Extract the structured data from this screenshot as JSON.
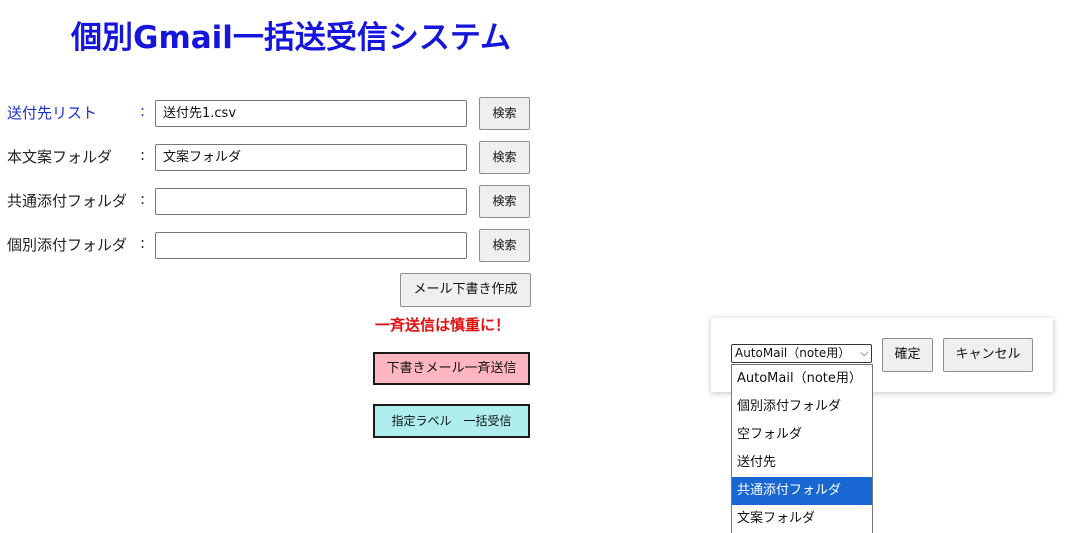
{
  "title": "個別Gmail一括送受信システム",
  "form": {
    "rows": [
      {
        "label": "送付先リスト",
        "colon": ":",
        "value": "送付先1.csv",
        "button": "検索"
      },
      {
        "label": "本文案フォルダ",
        "colon": ":",
        "value": "文案フォルダ",
        "button": "検索"
      },
      {
        "label": "共通添付フォルダ",
        "colon": ":",
        "value": "",
        "button": "検索"
      },
      {
        "label": "個別添付フォルダ",
        "colon": ":",
        "value": "",
        "button": "検索"
      }
    ],
    "draft_button": "メール下書き作成",
    "warning": "一斉送信は慎重に！",
    "send_button": "下書きメール一斉送信",
    "receive_button": "指定ラベル　一括受信"
  },
  "dialog": {
    "select_value": "AutoMail（note用）",
    "confirm_button": "確定",
    "cancel_button": "キャンセル",
    "options": [
      "AutoMail（note用）",
      "個別添付フォルダ",
      "空フォルダ",
      "送付先",
      "共通添付フォルダ",
      "文案フォルダ"
    ],
    "highlighted_option": "共通添付フォルダ"
  },
  "colors": {
    "title": "#1515dd",
    "active_label": "#1a2fd6",
    "warning": "#e01010",
    "send_button_bg": "#ffb6c1",
    "receive_button_bg": "#aeeeee",
    "option_highlight": "#1967d2"
  }
}
